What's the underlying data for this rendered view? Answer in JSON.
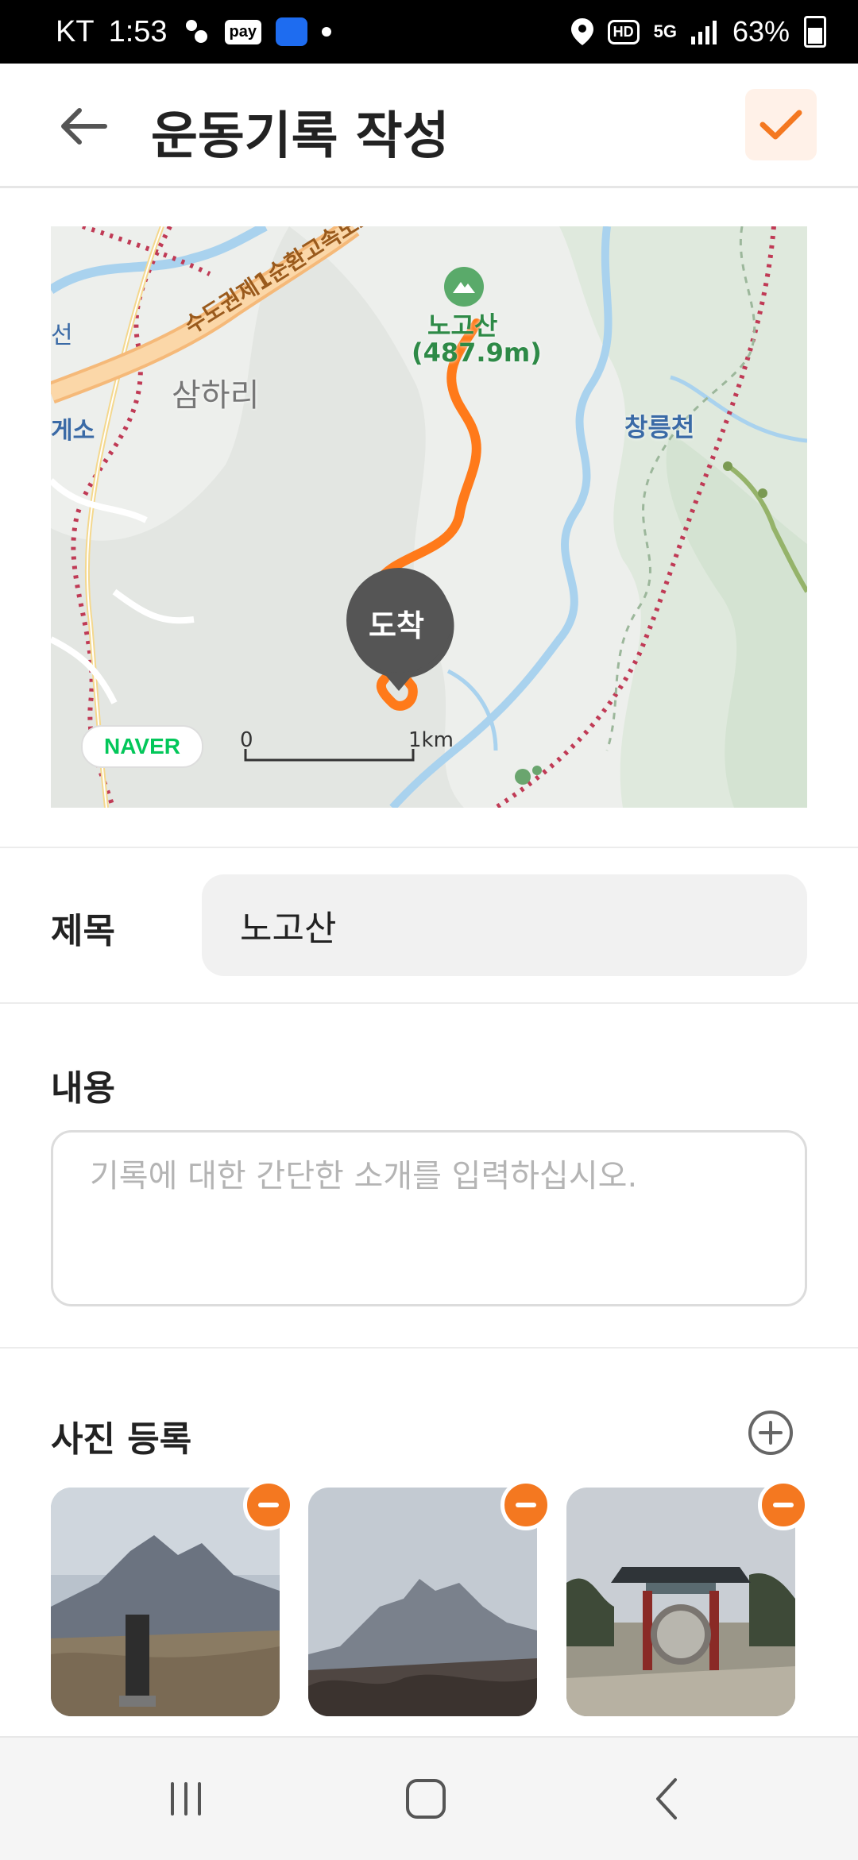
{
  "status_bar": {
    "carrier": "KT",
    "time": "1:53",
    "pay_label": "pay",
    "hd_label": "HD",
    "network": "5G",
    "battery": "63%",
    "icons": [
      "walking-app-icon",
      "pay-icon",
      "app-icon",
      "notification-dot",
      "location-icon",
      "hd-icon",
      "5g-icon",
      "signal-icon",
      "battery-icon"
    ]
  },
  "header": {
    "title": "운동기록 작성",
    "back_icon": "arrow-left-icon",
    "confirm_icon": "check-icon",
    "accent_color": "#f47820"
  },
  "map": {
    "places": {
      "mountain": "노고산",
      "elevation": "(487.9m)",
      "village": "삼하리",
      "stream": "창릉천",
      "highway": "수도권제1순환고속도로",
      "left_partial_1": "선",
      "left_partial_2": "게소"
    },
    "marker_label": "도착",
    "scale_start": "0",
    "scale_end": "1km",
    "provider_logo": "NAVER",
    "route_color": "#ff7a1a"
  },
  "form": {
    "title_label": "제목",
    "title_value": "노고산",
    "content_label": "내용",
    "content_placeholder": "기록에 대한 간단한 소개를 입력하십시오.",
    "photo_section_label": "사진 등록"
  },
  "photos": [
    {
      "name": "photo-mountain-signpost"
    },
    {
      "name": "photo-mountain-peak"
    },
    {
      "name": "photo-temple-gate"
    }
  ],
  "nav_bar": {
    "icons": [
      "recent-apps-icon",
      "home-icon",
      "back-icon"
    ]
  }
}
